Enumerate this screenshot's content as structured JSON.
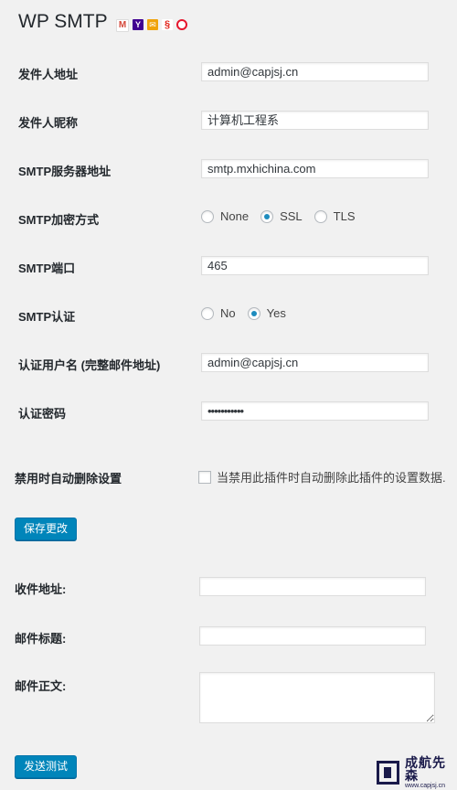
{
  "page": {
    "title": "WP SMTP"
  },
  "icons": {
    "providers": [
      "gmail-icon",
      "yahoo-icon",
      "mail-icon",
      "netease-icon",
      "sina-icon"
    ],
    "colors": {
      "gmail": "#d44638",
      "yahoo": "#400191",
      "mail": "#f0a30a",
      "netease": "#e2231a",
      "sina": "#e6162d"
    }
  },
  "form": {
    "from_address": {
      "label": "发件人地址",
      "value": "admin@capjsj.cn"
    },
    "from_name": {
      "label": "发件人昵称",
      "value": "计算机工程系"
    },
    "smtp_host": {
      "label": "SMTP服务器地址",
      "value": "smtp.mxhichina.com"
    },
    "smtp_secure": {
      "label": "SMTP加密方式",
      "options": [
        "None",
        "SSL",
        "TLS"
      ],
      "selected": "SSL"
    },
    "smtp_port": {
      "label": "SMTP端口",
      "value": "465"
    },
    "smtp_auth": {
      "label": "SMTP认证",
      "options": [
        "No",
        "Yes"
      ],
      "selected": "Yes"
    },
    "username": {
      "label": "认证用户名 (完整邮件地址)",
      "value": "admin@capjsj.cn"
    },
    "password": {
      "label": "认证密码",
      "value": "•••••••••••"
    },
    "delete_on_disable": {
      "label": "禁用时自动删除设置",
      "checkbox_label": "当禁用此插件时自动删除此插件的设置数据.",
      "checked": false
    },
    "save_button": "保存更改"
  },
  "test": {
    "to": {
      "label": "收件地址:",
      "value": ""
    },
    "subject": {
      "label": "邮件标题:",
      "value": ""
    },
    "body": {
      "label": "邮件正文:",
      "value": ""
    },
    "send_button": "发送测试"
  },
  "watermark": {
    "name": "成航先森",
    "url": "www.capjsj.cn"
  }
}
